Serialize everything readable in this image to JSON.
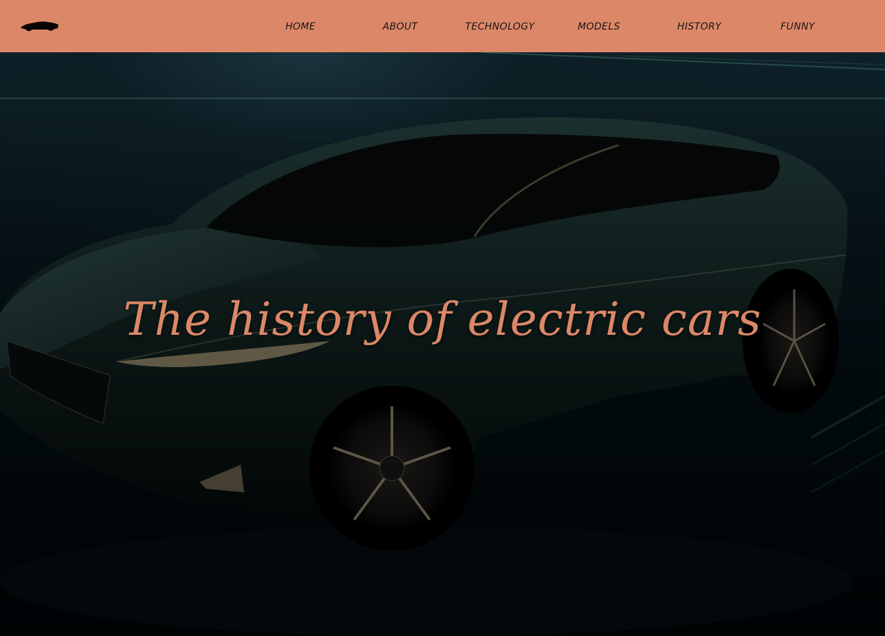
{
  "navbar": {
    "logo_icon": "car-silhouette-icon",
    "items": [
      {
        "label": "HOME"
      },
      {
        "label": "ABOUT"
      },
      {
        "label": "TECHNOLOGY"
      },
      {
        "label": "MODELS"
      },
      {
        "label": "HISTORY"
      },
      {
        "label": "FUNNY"
      }
    ]
  },
  "hero": {
    "title": "The history of electric cars",
    "background_image": "dark-green-electric-suv-image"
  },
  "colors": {
    "accent": "#dc8868",
    "nav_text": "#1a1414",
    "hero_bg": "#02080c"
  }
}
